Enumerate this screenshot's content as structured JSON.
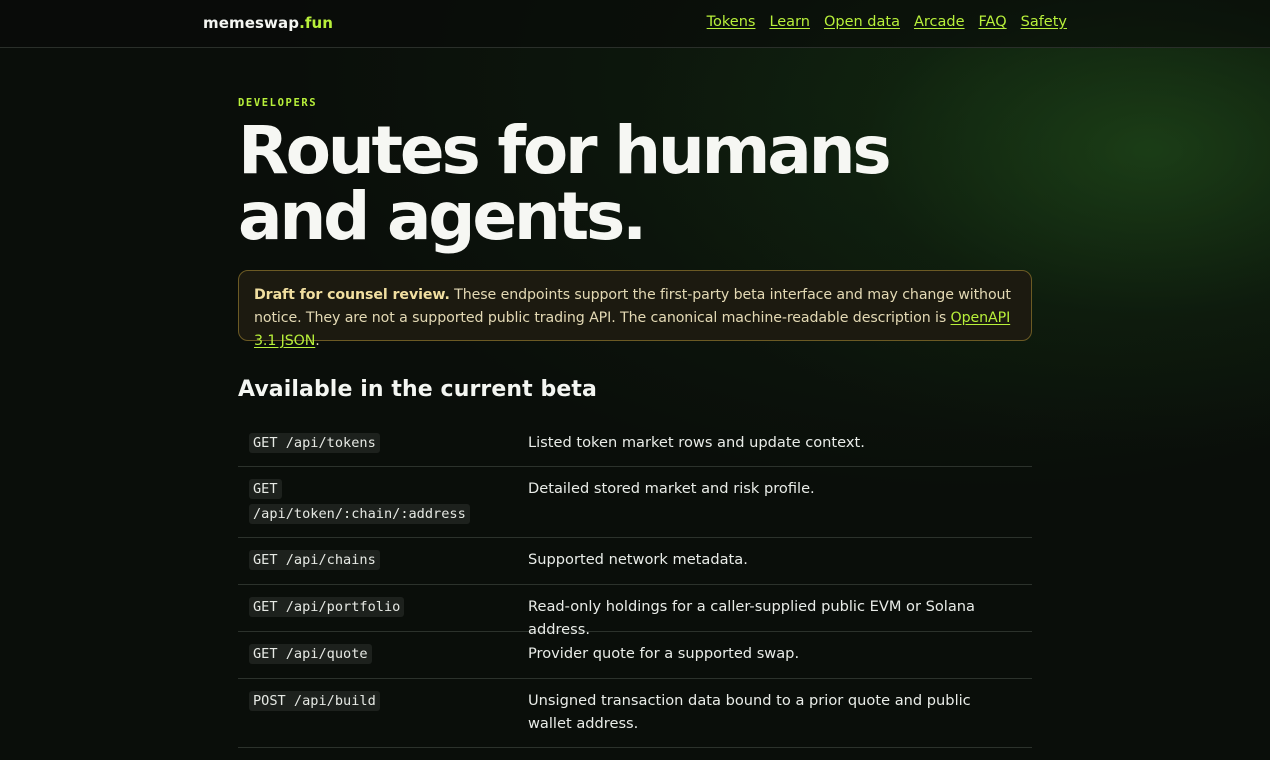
{
  "brand": {
    "name": "memeswap",
    "tld": ".fun"
  },
  "nav": [
    {
      "label": "Tokens"
    },
    {
      "label": "Learn"
    },
    {
      "label": "Open data"
    },
    {
      "label": "Arcade"
    },
    {
      "label": "FAQ"
    },
    {
      "label": "Safety"
    }
  ],
  "hero": {
    "eyebrow": "DEVELOPERS",
    "title": "Routes for humans and agents."
  },
  "notice": {
    "bold": "Draft for counsel review.",
    "text": " These endpoints support the first-party beta interface and may change without notice. They are not a supported public trading API. The canonical machine-readable description is ",
    "link": "OpenAPI 3.1 JSON",
    "end": "."
  },
  "routes": {
    "title": "Available in the current beta",
    "items": [
      {
        "method_path": "GET /api/tokens",
        "description": "Listed token market rows and update context."
      },
      {
        "method_path": "GET /api/token/:chain/:address",
        "description": "Detailed stored market and risk profile."
      },
      {
        "method_path": "GET /api/chains",
        "description": "Supported network metadata."
      },
      {
        "method_path": "GET /api/portfolio",
        "description": "Read-only holdings for a caller-supplied public EVM or Solana address."
      },
      {
        "method_path": "GET /api/quote",
        "description": "Provider quote for a supported swap."
      },
      {
        "method_path": "POST /api/build",
        "description": "Unsigned transaction data bound to a prior quote and public wallet address."
      }
    ]
  },
  "colors": {
    "accent": "#b8f03a",
    "background": "#0a0e0a",
    "notice_border": "#6c5a24",
    "notice_bg": "#1c1a10"
  }
}
